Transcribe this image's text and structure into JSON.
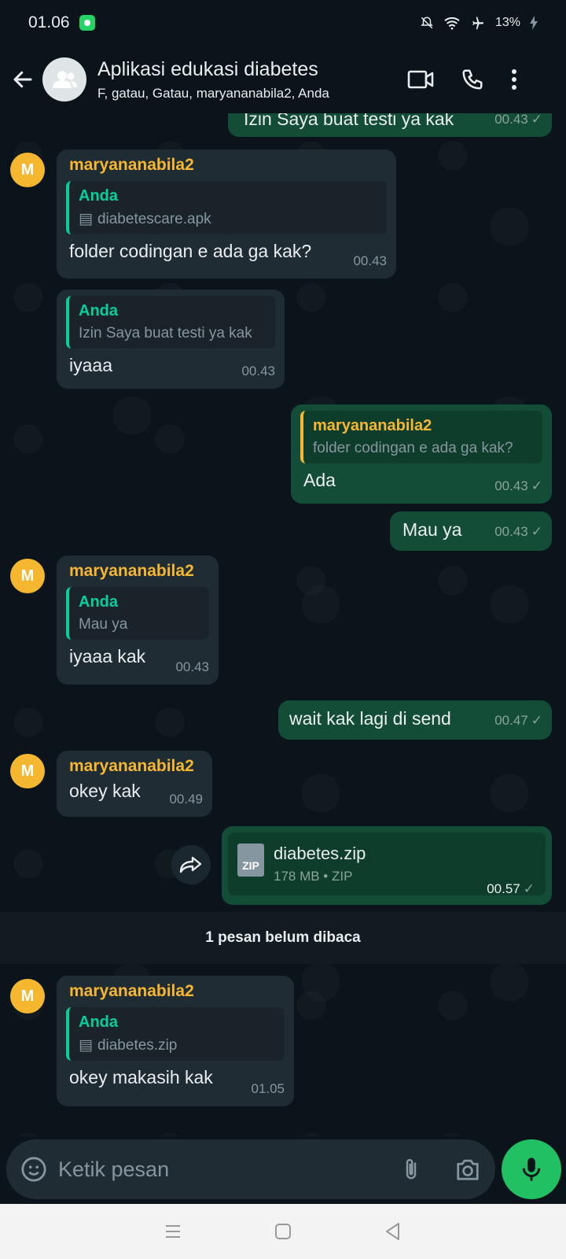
{
  "status_bar": {
    "time": "01.06",
    "battery": "13%"
  },
  "header": {
    "title": "Aplikasi edukasi diabetes",
    "members": "F, gatau, Gatau, maryananabila2, Anda"
  },
  "colors": {
    "accent": "#21c063",
    "sender": "#f5b630",
    "quote_green": "#06cf9c",
    "outgoing": "#144d37",
    "incoming": "#202c33"
  },
  "messages": {
    "m0": {
      "text": "Izin Saya buat testi ya kak",
      "time": "00.43"
    },
    "m1": {
      "sender": "maryananabila2",
      "avatar": "M",
      "quote_name": "Anda",
      "quote_text": "diabetescare.apk",
      "text": "folder codingan e ada ga kak?",
      "time": "00.43"
    },
    "m2": {
      "quote_name": "Anda",
      "quote_text": "Izin Saya buat testi ya kak",
      "text": "iyaaa",
      "time": "00.43"
    },
    "m3": {
      "quote_name": "maryananabila2",
      "quote_text": "folder codingan e ada ga kak?",
      "text": "Ada",
      "time": "00.43"
    },
    "m4": {
      "text": "Mau ya",
      "time": "00.43"
    },
    "m5": {
      "sender": "maryananabila2",
      "avatar": "M",
      "quote_name": "Anda",
      "quote_text": "Mau ya",
      "text": "iyaaa kak",
      "time": "00.43"
    },
    "m6": {
      "text": "wait kak lagi di send",
      "time": "00.47"
    },
    "m7": {
      "sender": "maryananabila2",
      "avatar": "M",
      "text": "okey kak",
      "time": "00.49"
    },
    "m8": {
      "file_name": "diabetes.zip",
      "file_meta": "178 MB • ZIP",
      "file_type": "ZIP",
      "time": "00.57"
    },
    "m9": {
      "sender": "maryananabila2",
      "avatar": "M",
      "quote_name": "Anda",
      "quote_text": "diabetes.zip",
      "text": "okey makasih kak",
      "time": "01.05"
    }
  },
  "unread_label": "1 pesan belum dibaca",
  "composer": {
    "placeholder": "Ketik pesan"
  }
}
